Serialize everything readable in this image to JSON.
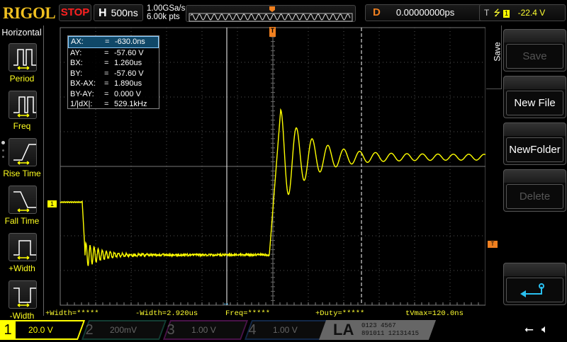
{
  "header": {
    "logo": "RIGOL",
    "run_state": "STOP",
    "h_label": "H",
    "timebase": "500ns",
    "sample_rate": "1.00GSa/s",
    "memory_depth": "6.00k pts",
    "trigger_marker": "T",
    "delay_label": "D",
    "delay": "0.00000000ps",
    "trig_label": "T",
    "trig_channel": "1",
    "trig_level": "-22.4 V"
  },
  "sidebar": {
    "title": "Horizontal",
    "items": [
      {
        "label": "Period",
        "icon": "period-icon"
      },
      {
        "label": "Freq",
        "icon": "freq-icon"
      },
      {
        "label": "Rise Time",
        "icon": "rise-time-icon"
      },
      {
        "label": "Fall Time",
        "icon": "fall-time-icon"
      },
      {
        "label": "+Width",
        "icon": "positive-width-icon"
      },
      {
        "label": "-Width",
        "icon": "negative-width-icon"
      }
    ]
  },
  "cursors": [
    {
      "k": "AX:",
      "v": "-630.0ns"
    },
    {
      "k": "AY:",
      "v": "-57.60 V"
    },
    {
      "k": "BX:",
      "v": "1.260us"
    },
    {
      "k": "BY:",
      "v": "-57.60 V"
    },
    {
      "k": "BX-AX:",
      "v": "1.890us"
    },
    {
      "k": "BY-AY:",
      "v": "0.000 V"
    },
    {
      "k": "1/|dX|:",
      "v": "529.1kHz"
    }
  ],
  "cursor_eq": "=",
  "measurements": [
    "+Width=*****",
    "-Width=2.920us",
    "Freq=*****",
    "+Duty=*****",
    "tVmax=120.0ns"
  ],
  "menu": {
    "title": "Save",
    "buttons": [
      {
        "label": "Save",
        "enabled": false
      },
      {
        "label": "New File",
        "enabled": true
      },
      {
        "label": "NewFolder",
        "enabled": true
      },
      {
        "label": "Delete",
        "enabled": false
      }
    ],
    "back": "back-icon"
  },
  "channels": [
    {
      "num": "1",
      "scale": "20.0 V",
      "color": "#ffff00",
      "active": true
    },
    {
      "num": "2",
      "scale": "200mV",
      "color": "#20a080",
      "active": false
    },
    {
      "num": "3",
      "scale": "1.00 V",
      "color": "#c020c0",
      "active": false
    },
    {
      "num": "4",
      "scale": "1.00 V",
      "color": "#2060c0",
      "active": false
    }
  ],
  "la": {
    "label": "LA",
    "row1": "0123 4567",
    "row2": "891011 12131415"
  },
  "ch1_marker": "1",
  "trig_level_marker": "T",
  "colors": {
    "ch1": "#ffff00",
    "trigger": "#f08020",
    "cursor": "#40c0ff"
  }
}
